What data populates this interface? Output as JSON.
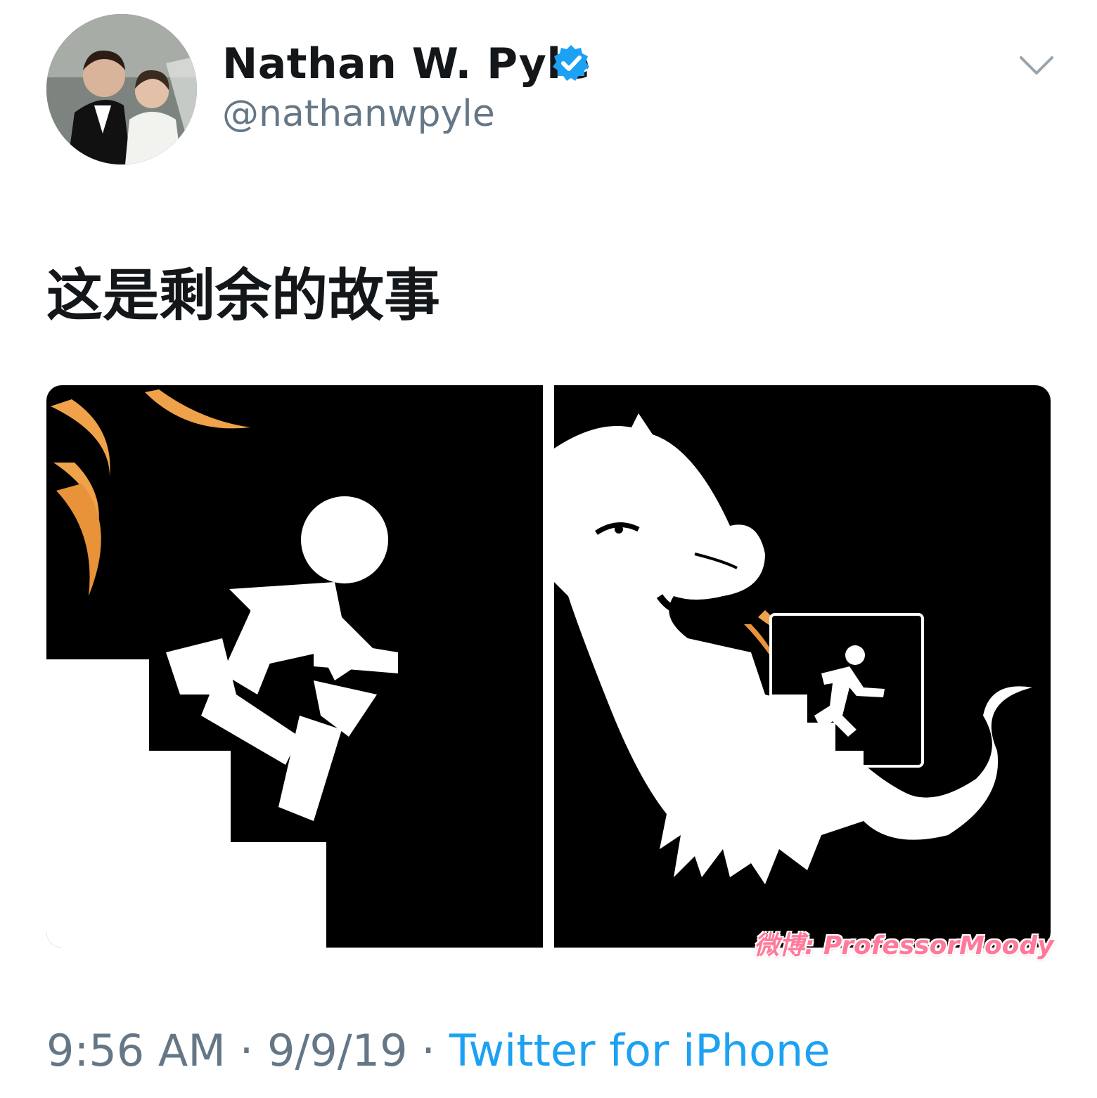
{
  "tweet": {
    "author": {
      "name": "Nathan W. Pyle",
      "handle": "@nathanwpyle",
      "verified": true
    },
    "text": "这是剩余的故事",
    "time": "9:56 AM",
    "separator": "·",
    "date": "9/9/19",
    "source": "Twitter for iPhone"
  },
  "media": {
    "watermark": "微博: ProfessorMoody"
  },
  "colors": {
    "verified_badge": "#1da1f2",
    "source_link": "#1da1f2",
    "meta_gray": "#657786",
    "flame": "#f0a24a",
    "watermark": "#ff7a9a"
  },
  "icons": {
    "verified": "verified-check-icon",
    "more": "chevron-down-icon"
  }
}
